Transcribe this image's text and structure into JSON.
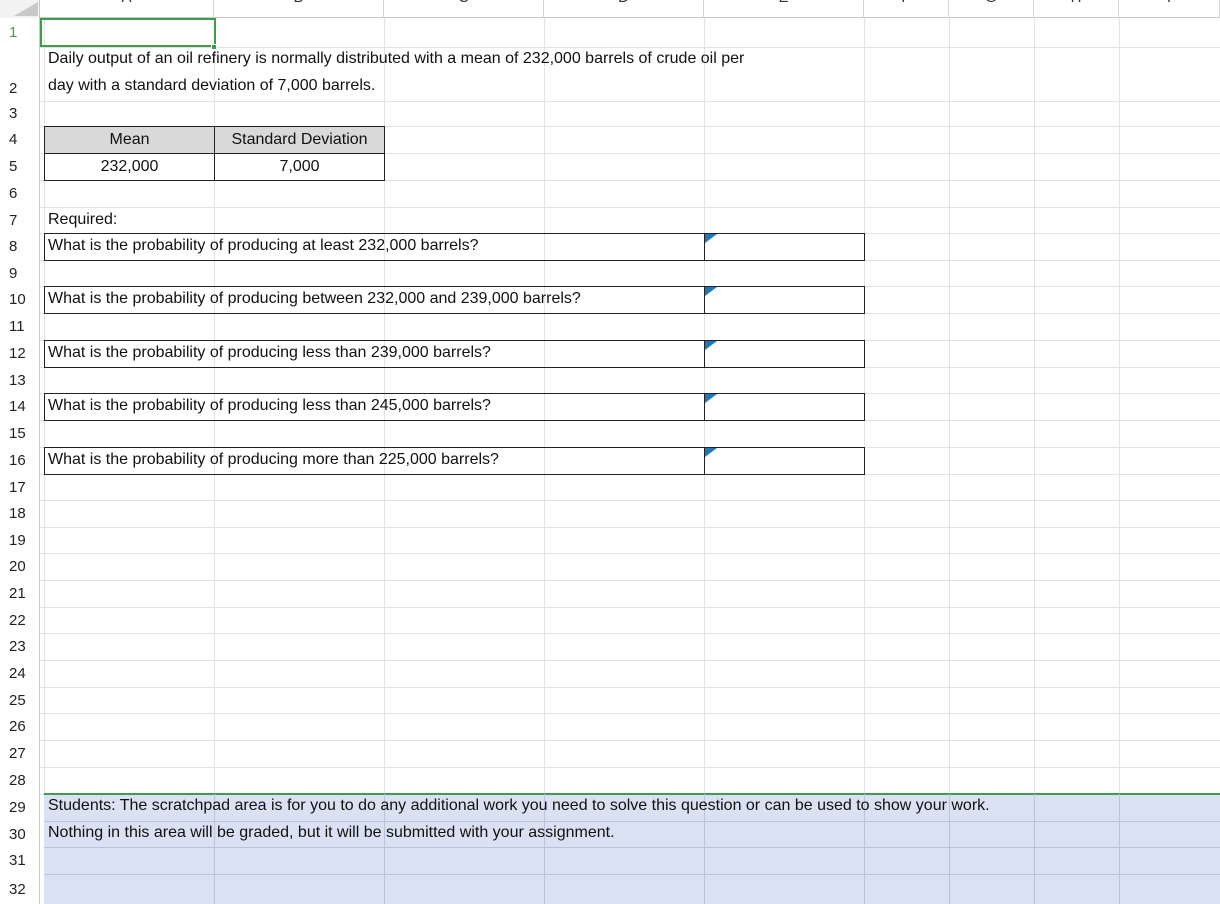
{
  "columns": [
    "A",
    "B",
    "C",
    "D",
    "E",
    "F",
    "G",
    "H",
    "I"
  ],
  "rows": [
    "1",
    "2",
    "3",
    "4",
    "5",
    "6",
    "7",
    "8",
    "9",
    "10",
    "11",
    "12",
    "13",
    "14",
    "15",
    "16",
    "17",
    "18",
    "19",
    "20",
    "21",
    "22",
    "23",
    "24",
    "25",
    "26",
    "27",
    "28",
    "29",
    "30",
    "31",
    "32"
  ],
  "intro": {
    "line1": "Daily output of an oil refinery is normally distributed with a mean of 232,000 barrels of crude oil per",
    "line2": "day with a standard deviation of 7,000 barrels."
  },
  "params_table": {
    "mean_header": "Mean",
    "sd_header": "Standard Deviation",
    "mean_value": "232,000",
    "sd_value": "7,000"
  },
  "required_label": "Required:",
  "questions": [
    "What is the probability of producing at least 232,000 barrels?",
    "What is the probability of producing between 232,000 and 239,000 barrels?",
    "What is the probability of producing less than 239,000 barrels?",
    "What is the probability of producing less than 245,000 barrels?",
    "What is the probability of producing more than 225,000 barrels?"
  ],
  "scratchpad": {
    "line1": "Students: The scratchpad area is for you to do any additional work you need to solve this question or can be used to show your work.",
    "line2": "Nothing in this area will be graded, but it will be submitted with your assignment."
  },
  "colors": {
    "selection": "#3f9c4a",
    "scratchpad_fill": "#d9e1f2",
    "header_fill": "#d9d9d9",
    "comment_marker": "#1f78b4"
  }
}
